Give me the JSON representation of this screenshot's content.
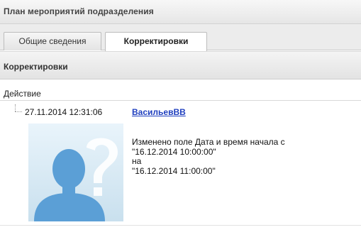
{
  "window": {
    "title": "План мероприятий подразделения"
  },
  "tabs": [
    {
      "label": "Общие сведения",
      "active": false
    },
    {
      "label": "Корректировки",
      "active": true
    }
  ],
  "section": {
    "title": "Корректировки"
  },
  "column": {
    "header": "Действие"
  },
  "entry": {
    "timestamp": "27.11.2014 12:31:06",
    "user": "ВасильевВВ",
    "avatar_icon": "user-placeholder-icon",
    "change_lines": [
      "Изменено поле Дата и время начала с",
      "\"16.12.2014 10:00:00\"",
      "на",
      "\"16.12.2014 11:00:00\""
    ]
  },
  "colors": {
    "link": "#1f3fbf",
    "avatar_bg": "#c9e0ee",
    "avatar_figure": "#5b9fd6"
  }
}
